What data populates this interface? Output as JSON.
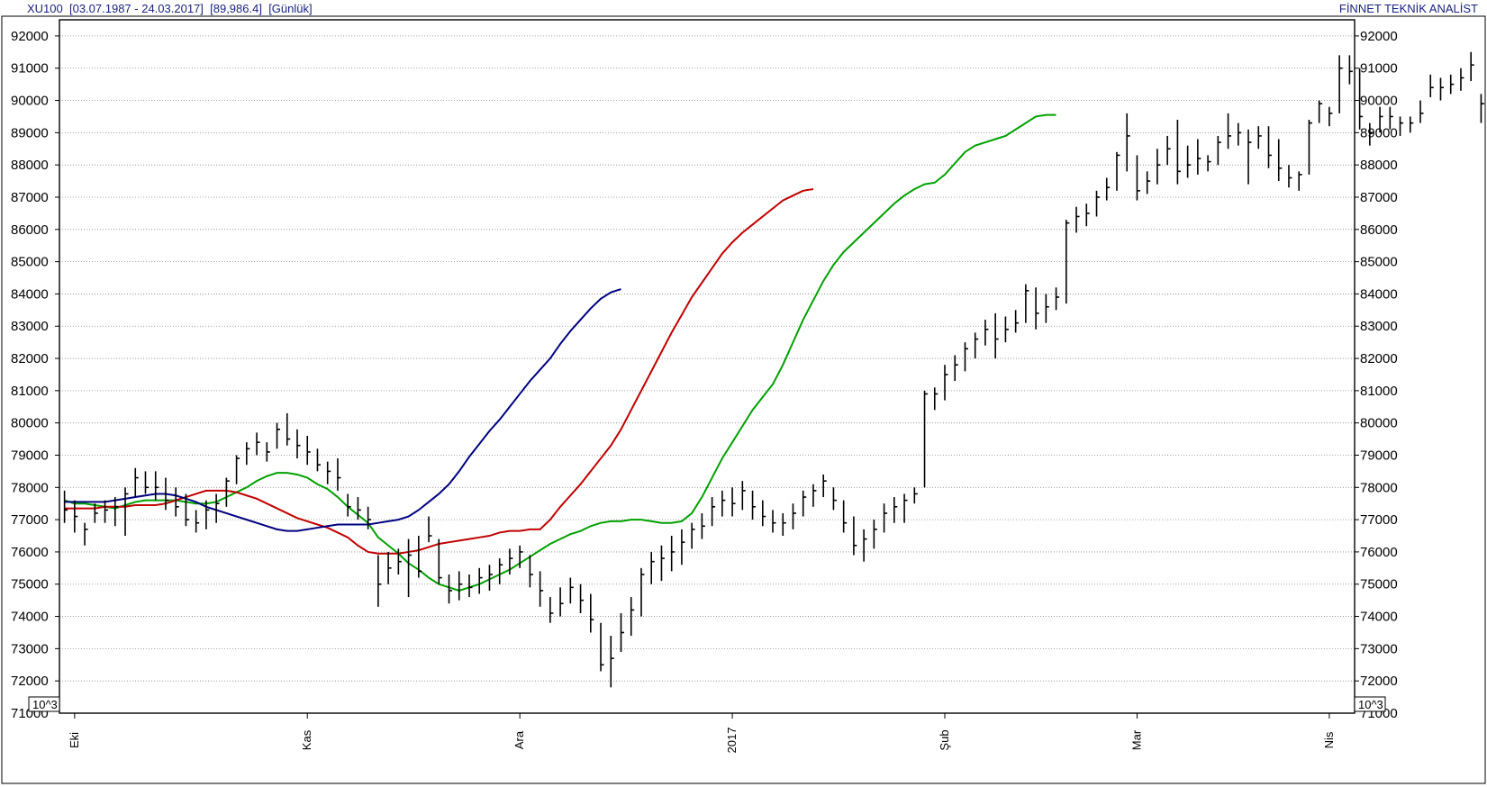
{
  "header": {
    "symbol": "XU100",
    "range": "[03.07.1987 - 24.03.2017]",
    "last_value": "[89,986.4]",
    "period": "[Günlük]",
    "provider": "FİNNET TEKNİK ANALİST"
  },
  "chart_data": {
    "type": "ohlc",
    "title": "",
    "xlabel": "",
    "ylabel": "",
    "ylim": [
      71000,
      92500
    ],
    "grid": true,
    "y_ticks": [
      72000,
      73000,
      74000,
      75000,
      76000,
      77000,
      78000,
      79000,
      80000,
      81000,
      82000,
      83000,
      84000,
      85000,
      86000,
      87000,
      88000,
      89000,
      90000,
      91000,
      92000
    ],
    "y_tick_labels": [
      "72000",
      "73000",
      "74000",
      "75000",
      "76000",
      "77000",
      "78000",
      "79000",
      "80000",
      "81000",
      "82000",
      "83000",
      "84000",
      "85000",
      "86000",
      "87000",
      "88000",
      "89000",
      "90000",
      "91000",
      "92000"
    ],
    "y_axis_bottom_label": "71000",
    "scale_label": "10^3",
    "x_ticks": [
      {
        "label": "Eki",
        "bar_index": 1
      },
      {
        "label": "Kas",
        "bar_index": 24
      },
      {
        "label": "Ara",
        "bar_index": 45
      },
      {
        "label": "2017",
        "bar_index": 66
      },
      {
        "label": "Şub",
        "bar_index": 87
      },
      {
        "label": "Mar",
        "bar_index": 106
      },
      {
        "label": "Nis",
        "bar_index": 125
      }
    ],
    "bars": [
      {
        "h": 77900,
        "l": 76900,
        "c": 77300
      },
      {
        "h": 77600,
        "l": 76600,
        "c": 77100
      },
      {
        "h": 76900,
        "l": 76200,
        "c": 76700
      },
      {
        "h": 77500,
        "l": 76900,
        "c": 77200
      },
      {
        "h": 77600,
        "l": 76900,
        "c": 77300
      },
      {
        "h": 77700,
        "l": 76800,
        "c": 77400
      },
      {
        "h": 78000,
        "l": 76500,
        "c": 77800
      },
      {
        "h": 78600,
        "l": 77700,
        "c": 78300
      },
      {
        "h": 78500,
        "l": 77800,
        "c": 78000
      },
      {
        "h": 78500,
        "l": 77600,
        "c": 78000
      },
      {
        "h": 78300,
        "l": 77300,
        "c": 77600
      },
      {
        "h": 78000,
        "l": 77100,
        "c": 77400
      },
      {
        "h": 77800,
        "l": 76800,
        "c": 77000
      },
      {
        "h": 77300,
        "l": 76600,
        "c": 76900
      },
      {
        "h": 77600,
        "l": 76700,
        "c": 77300
      },
      {
        "h": 77800,
        "l": 76900,
        "c": 77500
      },
      {
        "h": 78300,
        "l": 77400,
        "c": 78200
      },
      {
        "h": 79000,
        "l": 78100,
        "c": 78900
      },
      {
        "h": 79400,
        "l": 78700,
        "c": 79200
      },
      {
        "h": 79700,
        "l": 79000,
        "c": 79400
      },
      {
        "h": 79400,
        "l": 78800,
        "c": 79100
      },
      {
        "h": 80000,
        "l": 79200,
        "c": 79800
      },
      {
        "h": 80300,
        "l": 79300,
        "c": 79500
      },
      {
        "h": 79800,
        "l": 78900,
        "c": 79300
      },
      {
        "h": 79600,
        "l": 78700,
        "c": 79100
      },
      {
        "h": 79200,
        "l": 78500,
        "c": 78700
      },
      {
        "h": 78800,
        "l": 78100,
        "c": 78500
      },
      {
        "h": 78900,
        "l": 77900,
        "c": 78300
      },
      {
        "h": 77800,
        "l": 77100,
        "c": 77400
      },
      {
        "h": 77700,
        "l": 77000,
        "c": 77300
      },
      {
        "h": 77400,
        "l": 76700,
        "c": 77000
      },
      {
        "h": 75900,
        "l": 74300,
        "c": 75000
      },
      {
        "h": 76000,
        "l": 75000,
        "c": 75500
      },
      {
        "h": 76100,
        "l": 75300,
        "c": 75700
      },
      {
        "h": 76400,
        "l": 74600,
        "c": 75900
      },
      {
        "h": 76500,
        "l": 75200,
        "c": 75400
      },
      {
        "h": 77100,
        "l": 76300,
        "c": 76500
      },
      {
        "h": 76400,
        "l": 75000,
        "c": 75200
      },
      {
        "h": 75300,
        "l": 74400,
        "c": 74800
      },
      {
        "h": 75400,
        "l": 74500,
        "c": 75000
      },
      {
        "h": 75300,
        "l": 74600,
        "c": 74900
      },
      {
        "h": 75500,
        "l": 74700,
        "c": 75200
      },
      {
        "h": 75600,
        "l": 74800,
        "c": 75300
      },
      {
        "h": 75800,
        "l": 75000,
        "c": 75600
      },
      {
        "h": 76100,
        "l": 75300,
        "c": 75800
      },
      {
        "h": 76200,
        "l": 75500,
        "c": 76000
      },
      {
        "h": 75900,
        "l": 74900,
        "c": 75300
      },
      {
        "h": 75400,
        "l": 74300,
        "c": 74800
      },
      {
        "h": 74600,
        "l": 73800,
        "c": 74100
      },
      {
        "h": 74900,
        "l": 74000,
        "c": 74400
      },
      {
        "h": 75200,
        "l": 74400,
        "c": 74900
      },
      {
        "h": 75000,
        "l": 74100,
        "c": 74500
      },
      {
        "h": 74700,
        "l": 73500,
        "c": 73900
      },
      {
        "h": 73800,
        "l": 72300,
        "c": 72500
      },
      {
        "h": 73400,
        "l": 71800,
        "c": 72700
      },
      {
        "h": 74100,
        "l": 72900,
        "c": 73500
      },
      {
        "h": 74600,
        "l": 73400,
        "c": 74200
      },
      {
        "h": 75500,
        "l": 74000,
        "c": 75300
      },
      {
        "h": 76000,
        "l": 75000,
        "c": 75700
      },
      {
        "h": 76200,
        "l": 75100,
        "c": 75800
      },
      {
        "h": 76500,
        "l": 75400,
        "c": 76000
      },
      {
        "h": 76700,
        "l": 75600,
        "c": 76300
      },
      {
        "h": 76900,
        "l": 76100,
        "c": 76700
      },
      {
        "h": 77200,
        "l": 76400,
        "c": 76800
      },
      {
        "h": 77700,
        "l": 76800,
        "c": 77400
      },
      {
        "h": 77900,
        "l": 77100,
        "c": 77600
      },
      {
        "h": 78000,
        "l": 77100,
        "c": 77500
      },
      {
        "h": 78200,
        "l": 77300,
        "c": 77900
      },
      {
        "h": 77900,
        "l": 77000,
        "c": 77400
      },
      {
        "h": 77600,
        "l": 76800,
        "c": 77100
      },
      {
        "h": 77300,
        "l": 76600,
        "c": 76900
      },
      {
        "h": 77200,
        "l": 76500,
        "c": 76900
      },
      {
        "h": 77500,
        "l": 76700,
        "c": 77200
      },
      {
        "h": 77900,
        "l": 77100,
        "c": 77700
      },
      {
        "h": 78100,
        "l": 77400,
        "c": 77900
      },
      {
        "h": 78400,
        "l": 77700,
        "c": 78200
      },
      {
        "h": 78000,
        "l": 77300,
        "c": 77600
      },
      {
        "h": 77600,
        "l": 76600,
        "c": 76900
      },
      {
        "h": 77100,
        "l": 75900,
        "c": 76200
      },
      {
        "h": 76700,
        "l": 75700,
        "c": 76400
      },
      {
        "h": 77000,
        "l": 76100,
        "c": 76700
      },
      {
        "h": 77500,
        "l": 76600,
        "c": 77200
      },
      {
        "h": 77700,
        "l": 76900,
        "c": 77400
      },
      {
        "h": 77800,
        "l": 76900,
        "c": 77600
      },
      {
        "h": 78000,
        "l": 77500,
        "c": 77800
      },
      {
        "h": 81000,
        "l": 78000,
        "c": 80900
      },
      {
        "h": 81100,
        "l": 80400,
        "c": 80900
      },
      {
        "h": 81800,
        "l": 80700,
        "c": 81500
      },
      {
        "h": 82100,
        "l": 81300,
        "c": 81800
      },
      {
        "h": 82500,
        "l": 81600,
        "c": 82300
      },
      {
        "h": 82800,
        "l": 82000,
        "c": 82600
      },
      {
        "h": 83200,
        "l": 82400,
        "c": 82900
      },
      {
        "h": 83400,
        "l": 82000,
        "c": 82600
      },
      {
        "h": 83300,
        "l": 82500,
        "c": 82900
      },
      {
        "h": 83500,
        "l": 82800,
        "c": 83100
      },
      {
        "h": 84300,
        "l": 83100,
        "c": 84100
      },
      {
        "h": 84200,
        "l": 82900,
        "c": 83400
      },
      {
        "h": 84000,
        "l": 83100,
        "c": 83600
      },
      {
        "h": 84200,
        "l": 83500,
        "c": 83900
      },
      {
        "h": 86300,
        "l": 83700,
        "c": 86200
      },
      {
        "h": 86700,
        "l": 85900,
        "c": 86400
      },
      {
        "h": 86800,
        "l": 86100,
        "c": 86500
      },
      {
        "h": 87200,
        "l": 86400,
        "c": 87000
      },
      {
        "h": 87600,
        "l": 86900,
        "c": 87300
      },
      {
        "h": 88400,
        "l": 87200,
        "c": 88300
      },
      {
        "h": 89600,
        "l": 87800,
        "c": 88900
      },
      {
        "h": 88300,
        "l": 86900,
        "c": 87200
      },
      {
        "h": 87800,
        "l": 87100,
        "c": 87500
      },
      {
        "h": 88500,
        "l": 87400,
        "c": 88000
      },
      {
        "h": 88900,
        "l": 88000,
        "c": 88500
      },
      {
        "h": 89400,
        "l": 87400,
        "c": 87800
      },
      {
        "h": 88600,
        "l": 87600,
        "c": 88000
      },
      {
        "h": 88800,
        "l": 87700,
        "c": 88200
      },
      {
        "h": 88300,
        "l": 87800,
        "c": 88100
      },
      {
        "h": 88900,
        "l": 88000,
        "c": 88700
      },
      {
        "h": 89600,
        "l": 88500,
        "c": 88900
      },
      {
        "h": 89300,
        "l": 88600,
        "c": 89000
      },
      {
        "h": 89100,
        "l": 87400,
        "c": 88700
      },
      {
        "h": 89200,
        "l": 88500,
        "c": 88900
      },
      {
        "h": 89200,
        "l": 87900,
        "c": 88300
      },
      {
        "h": 88800,
        "l": 87500,
        "c": 87900
      },
      {
        "h": 88000,
        "l": 87300,
        "c": 87600
      },
      {
        "h": 87800,
        "l": 87200,
        "c": 87700
      },
      {
        "h": 89400,
        "l": 87700,
        "c": 89300
      },
      {
        "h": 90000,
        "l": 89300,
        "c": 89900
      },
      {
        "h": 89800,
        "l": 89200,
        "c": 89600
      },
      {
        "h": 91400,
        "l": 89600,
        "c": 91000
      },
      {
        "h": 91400,
        "l": 90500,
        "c": 90900
      },
      {
        "h": 91000,
        "l": 89100,
        "c": 89500
      },
      {
        "h": 89300,
        "l": 88600,
        "c": 89000
      },
      {
        "h": 89800,
        "l": 89000,
        "c": 89500
      },
      {
        "h": 89800,
        "l": 89100,
        "c": 89500
      },
      {
        "h": 89500,
        "l": 88900,
        "c": 89300
      },
      {
        "h": 89500,
        "l": 89000,
        "c": 89300
      },
      {
        "h": 90000,
        "l": 89300,
        "c": 89600
      },
      {
        "h": 90800,
        "l": 90100,
        "c": 90400
      },
      {
        "h": 90700,
        "l": 90000,
        "c": 90400
      },
      {
        "h": 90800,
        "l": 90200,
        "c": 90500
      },
      {
        "h": 91000,
        "l": 90300,
        "c": 90700
      },
      {
        "h": 91500,
        "l": 90600,
        "c": 91100
      },
      {
        "h": 90200,
        "l": 89300,
        "c": 89900
      },
      {
        "h": 90100,
        "l": 89600,
        "c": 89900
      },
      {
        "h": 90100,
        "l": 89700,
        "c": 89986
      }
    ],
    "series": [
      {
        "color": "#00a000",
        "values": [
          77600,
          77500,
          77500,
          77450,
          77400,
          77350,
          77450,
          77550,
          77600,
          77600,
          77600,
          77600,
          77550,
          77500,
          77500,
          77550,
          77700,
          77850,
          78000,
          78200,
          78350,
          78450,
          78450,
          78400,
          78300,
          78100,
          77950,
          77700,
          77400,
          77150,
          76900,
          76450,
          76200,
          75950,
          75650,
          75450,
          75200,
          75000,
          74900,
          74800,
          74900,
          75000,
          75150,
          75300,
          75450,
          75650,
          75850,
          76050,
          76250,
          76400,
          76550,
          76650,
          76800,
          76900,
          76950,
          76950,
          77000,
          77000,
          76950,
          76900,
          76900,
          76950,
          77200,
          77700,
          78300,
          78900,
          79400,
          79900,
          80400,
          80800,
          81200,
          81800,
          82500,
          83200,
          83800,
          84400,
          84900,
          85300,
          85600,
          85900,
          86200,
          86500,
          86800,
          87050,
          87250,
          87400,
          87450,
          87700,
          88050,
          88400,
          88600,
          88700,
          88800,
          88900,
          89100,
          89300,
          89500,
          89550,
          89550
        ]
      },
      {
        "color": "#c00000",
        "values": [
          77350,
          77350,
          77350,
          77350,
          77400,
          77400,
          77400,
          77450,
          77450,
          77450,
          77500,
          77600,
          77700,
          77800,
          77900,
          77900,
          77900,
          77850,
          77750,
          77650,
          77500,
          77350,
          77200,
          77050,
          76950,
          76850,
          76750,
          76600,
          76450,
          76200,
          76000,
          75950,
          75950,
          75950,
          76000,
          76050,
          76150,
          76250,
          76300,
          76350,
          76400,
          76450,
          76500,
          76600,
          76650,
          76650,
          76700,
          76700,
          77000,
          77400,
          77750,
          78100,
          78500,
          78900,
          79300,
          79800,
          80400,
          81000,
          81600,
          82200,
          82800,
          83350,
          83900,
          84350,
          84800,
          85250,
          85600,
          85900,
          86150,
          86400,
          86650,
          86900,
          87050,
          87200,
          87250
        ]
      },
      {
        "color": "#000080",
        "values": [
          77550,
          77550,
          77550,
          77550,
          77550,
          77600,
          77650,
          77700,
          77750,
          77800,
          77800,
          77750,
          77650,
          77550,
          77400,
          77300,
          77200,
          77100,
          77000,
          76900,
          76800,
          76700,
          76650,
          76650,
          76700,
          76750,
          76800,
          76850,
          76850,
          76850,
          76850,
          76900,
          76950,
          77000,
          77100,
          77300,
          77550,
          77800,
          78100,
          78500,
          78950,
          79350,
          79750,
          80100,
          80500,
          80900,
          81300,
          81650,
          82000,
          82450,
          82850,
          83200,
          83550,
          83850,
          84050,
          84150
        ]
      }
    ]
  }
}
